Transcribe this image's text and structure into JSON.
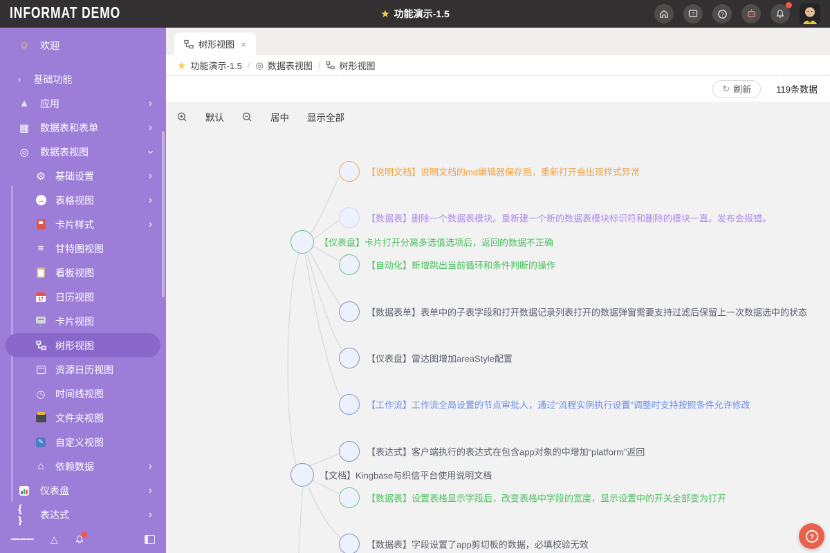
{
  "header": {
    "logo": "INFORMAT DEMO",
    "title": "功能演示-1.5",
    "action_icons": [
      "home-icon",
      "feedback-icon",
      "help-icon",
      "robot-icon",
      "bell-icon"
    ],
    "notification_badge": true
  },
  "sidebar": {
    "items": [
      {
        "label": "欢迎"
      },
      {
        "label": "基础功能"
      },
      {
        "label": "应用"
      },
      {
        "label": "数据表和表单"
      },
      {
        "label": "数据表视图"
      },
      {
        "label": "基础设置"
      },
      {
        "label": "表格视图"
      },
      {
        "label": "卡片样式"
      },
      {
        "label": "甘特图视图"
      },
      {
        "label": "看板视图"
      },
      {
        "label": "日历视图"
      },
      {
        "label": "卡片视图"
      },
      {
        "label": "树形视图"
      },
      {
        "label": "资源日历视图"
      },
      {
        "label": "时间线视图"
      },
      {
        "label": "文件夹视图"
      },
      {
        "label": "自定义视图"
      },
      {
        "label": "依赖数据"
      },
      {
        "label": "仪表盘"
      },
      {
        "label": "表达式"
      }
    ],
    "selected": "树形视图"
  },
  "tabs": [
    {
      "label": "树形视图"
    }
  ],
  "breadcrumb": {
    "separator": "/",
    "items": [
      "功能演示-1.5",
      "数据表视图",
      "树形视图"
    ]
  },
  "toolbar": {
    "refresh_label": "刷新",
    "count_label": "119条数据"
  },
  "canvas_toolbar": {
    "default_label": "默认",
    "center_label": "居中",
    "show_all_label": "显示全部"
  },
  "tree": {
    "nodes": [
      {
        "text": "【说明文档】说明文档的md编辑器保存后，重新打开会出现样式异常",
        "color": "orange"
      },
      {
        "text": "【数据表】删除一个数据表模块。重新建一个新的数据表模块标识符和删除的模块一直。发布会报错。",
        "color": "lilac"
      },
      {
        "text": "【仪表盘】卡片打开分离多选值选项后，返回的数据不正确",
        "color": "green"
      },
      {
        "text": "【自动化】新增跳出当前循环和条件判断的操作",
        "color": "green"
      },
      {
        "text": "【数据表单】表单中的子表字段和打开数据记录列表打开的数据弹窗需要支持过滤后保留上一次数据选中的状态",
        "color": "slate"
      },
      {
        "text": "【仪表盘】雷达图增加areaStyle配置",
        "color": "slate"
      },
      {
        "text": "【工作流】工作流全局设置的节点审批人，通过“流程实例执行设置”调整时支持按照条件允许修改",
        "color": "blue"
      },
      {
        "text": "【表达式】客户端执行的表达式在包含app对象的中增加“platform”返回",
        "color": "slate"
      },
      {
        "text": "【文档】Kingbase与织信平台使用说明文档",
        "color": "slate"
      },
      {
        "text": "【数据表】设置表格显示字段后，改变表格中字段的宽度，显示设置中的开关全部变为打开",
        "color": "green"
      },
      {
        "text": "【数据表】字段设置了app剪切板的数据，必填校验无效",
        "color": "slate"
      }
    ]
  },
  "icons": {
    "smiley": "☺",
    "chevron": "›",
    "mountain": "▲",
    "table": "▦",
    "view": "◎",
    "gear": "⚙",
    "lines": "≡",
    "clock": "◷",
    "home": "⌂",
    "braces": "{ }",
    "star": "★",
    "close": "×",
    "refresh": "↻",
    "triangle": "△"
  },
  "colors": {
    "header_bg": "#323030",
    "sidebar_bg": "#9c7dd8",
    "sidebar_selected": "#8a67cb",
    "canvas_bg": "#f2f2f3",
    "node_orange": "#f0a13e",
    "node_lilac": "#ab8ce4",
    "node_green": "#4bbf5e",
    "node_blue": "#6f8ee4",
    "node_slate": "#5a5f68",
    "help_button": "#e8614d",
    "badge_red": "#f5554a"
  }
}
